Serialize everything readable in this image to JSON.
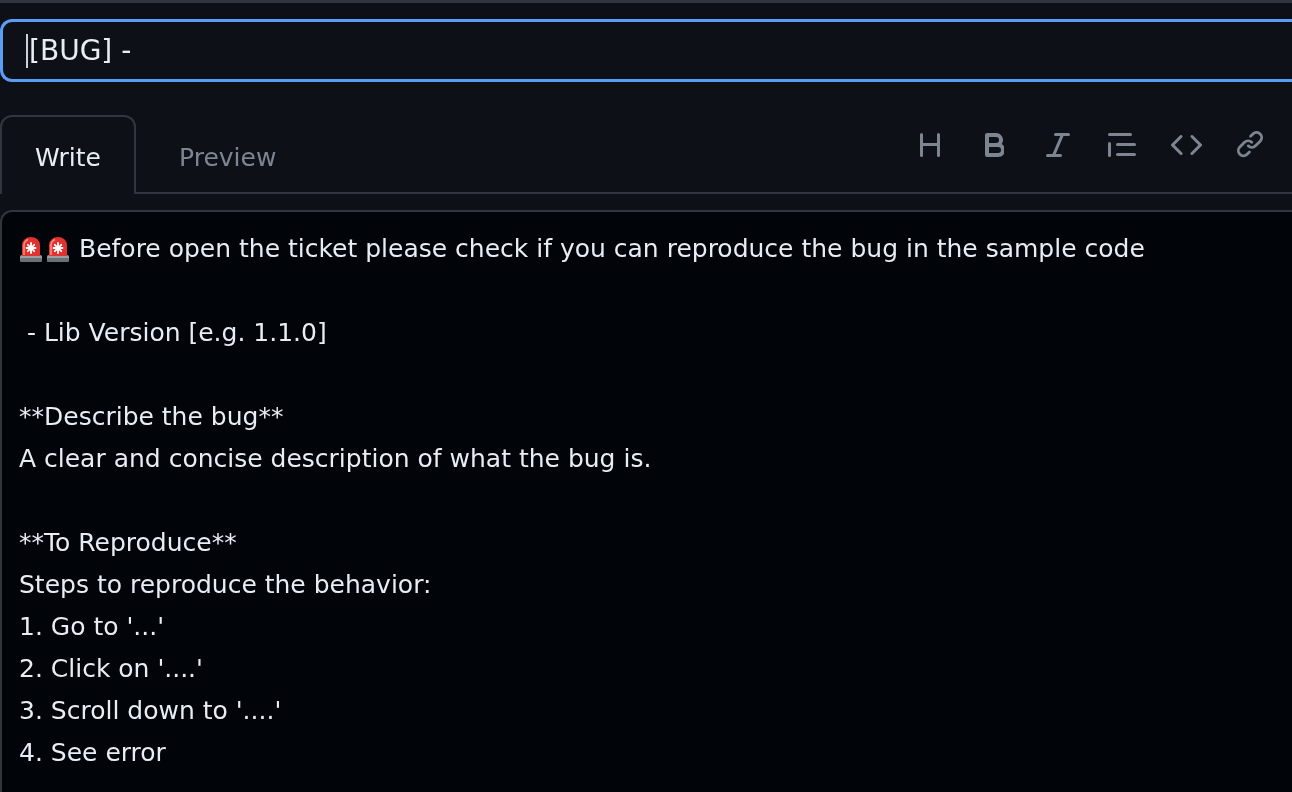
{
  "title_field": {
    "value": "[BUG] -",
    "focused": true
  },
  "tabs": [
    {
      "label": "Write",
      "selected": true
    },
    {
      "label": "Preview",
      "selected": false
    }
  ],
  "body_field": {
    "paragraphs": [
      {
        "kind": "alert",
        "lines": [
          "Before open the ticket please check if you can reproduce the bug in the sample code"
        ]
      },
      {
        "kind": "plain",
        "lines": [
          " - Lib Version [e.g. 1.1.0]"
        ]
      },
      {
        "kind": "plain",
        "lines": [
          "**Describe the bug**",
          "A clear and concise description of what the bug is."
        ]
      },
      {
        "kind": "plain",
        "lines": [
          "**To Reproduce**",
          "Steps to reproduce the behavior:",
          "1. Go to '...'",
          "2. Click on '....'",
          "3. Scroll down to '....'",
          "4. See error"
        ]
      }
    ]
  }
}
